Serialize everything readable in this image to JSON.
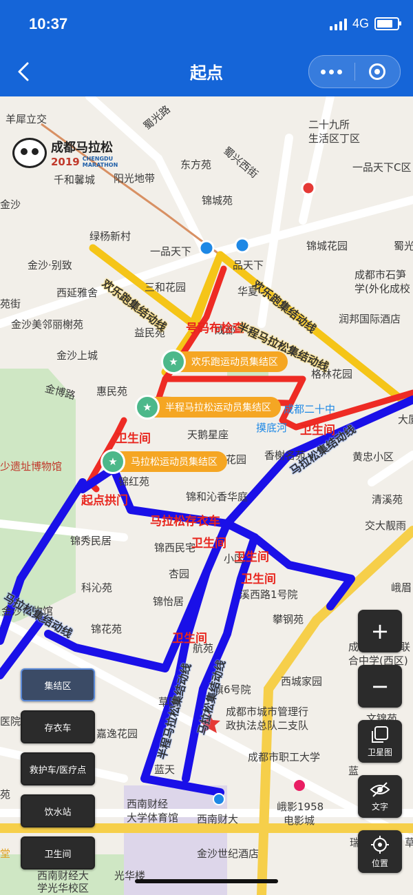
{
  "status": {
    "time": "10:37",
    "network": "4G"
  },
  "nav": {
    "title": "起点"
  },
  "logo": {
    "name": "成都马拉松",
    "year": "2019",
    "sub1": "CHENGDU",
    "sub2": "MARATHON"
  },
  "map_labels": [
    "羊犀立交",
    "二十九所",
    "生活区丁区",
    "蜀光路",
    "东方苑",
    "蜀兴西街",
    "一品天下C区",
    "千和馨城",
    "阳光地带",
    "金沙",
    "锦城苑",
    "绿杨新村",
    "一品天下",
    "品天下",
    "锦城花园",
    "蜀光",
    "金沙·别致",
    "西延雅舍",
    "三和花园",
    "华夏",
    "成都市石笋",
    "学(外化成校",
    "苑街",
    "金沙美邻丽榭苑",
    "益民苑",
    "成都",
    "润邦国际酒店",
    "金沙上城",
    "格林花园",
    "惠民苑",
    "金博路",
    "成都二十中",
    "天鹅星座",
    "摸底河",
    "香榭名苑",
    "黄忠小区",
    "少遗址博物馆",
    "锦红苑",
    "花园",
    "锦和沁香华庭",
    "清溪苑",
    "锦秀民居",
    "锦西民宅",
    "小区",
    "交大靓雨",
    "杏园",
    "峨眉",
    "科沁苑",
    "锦怡居",
    "溪西路1号院",
    "攀钢苑",
    "锦花苑",
    "金沙博物馆",
    "航苑",
    "成都市石室联",
    "合中学(西区)",
    "西城家园",
    "旗6号院",
    "成都市城市管理行",
    "政执法总队二支队",
    "医院",
    "嘉逸花园",
    "草园",
    "成都市职工大学",
    "文锦苑",
    "蓝天",
    "蓝",
    "苑",
    "西南财经",
    "大学体育馆",
    "西南财大",
    "峨影1958",
    "电影城",
    "瑞",
    "草",
    "金沙世纪酒店",
    "西南财经大",
    "学光华校区",
    "光华楼",
    "堂",
    "大厦"
  ],
  "route_labels": {
    "fun_run": "欢乐跑集结动线",
    "bib_check": "号码布检查",
    "start_arch": "起点拱门",
    "bag_truck": "马拉松存衣车",
    "toilets": [
      "卫生间",
      "卫生间",
      "卫生间",
      "卫生间",
      "卫生间",
      "卫生间"
    ],
    "half_line": "半程马拉松集结动线",
    "fun_line2": "欢乐跑集结动线",
    "marathon_line": "马拉松集结动线",
    "half_line2": "半程马拉松集结动线",
    "marathon_line2": "马拉松集结动线",
    "left_line": "马拉松集结动线"
  },
  "assembly_pills": [
    {
      "label": "欢乐跑运动员集结区"
    },
    {
      "label": "半程马拉松运动员集结区"
    },
    {
      "label": "马拉松运动员集结区"
    }
  ],
  "layer_buttons": [
    "集结区",
    "存衣车",
    "救护车/医疗点",
    "饮水站",
    "卫生间"
  ],
  "tools": {
    "zoom_in": "+",
    "zoom_out": "−",
    "satellite": "卫星图",
    "text": "文字",
    "location": "位置"
  },
  "colors": {
    "header": "#1565d8",
    "route_blue": "#1a10e8",
    "route_red": "#ee2b24",
    "route_yellow": "#f5c518",
    "pill": "#f5a623"
  }
}
